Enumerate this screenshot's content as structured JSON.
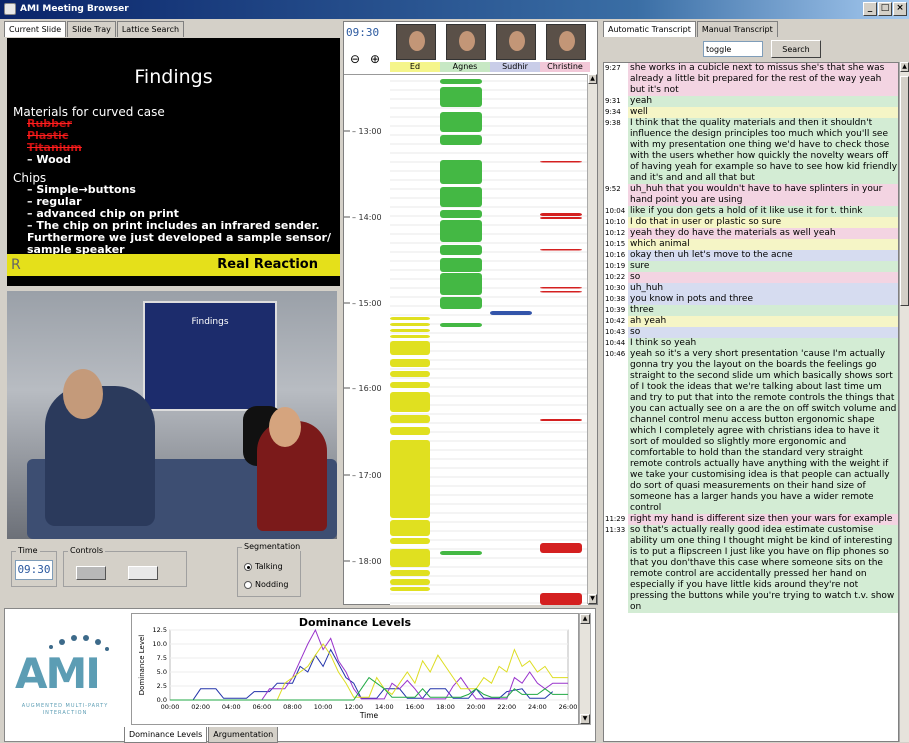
{
  "window": {
    "title": "AMI Meeting Browser",
    "buttons": [
      "_",
      "□",
      "×"
    ]
  },
  "left_tabs": [
    "Current Slide",
    "Slide Tray",
    "Lattice Search"
  ],
  "slide": {
    "title": "Findings",
    "items": [
      {
        "level": 1,
        "text": "Materials for curved case",
        "strike": false
      },
      {
        "level": 2,
        "text": "Rubber",
        "strike": true
      },
      {
        "level": 2,
        "text": "Plastic",
        "strike": true
      },
      {
        "level": 2,
        "text": "Titanium",
        "strike": true
      },
      {
        "level": 2,
        "text": "– Wood",
        "strike": false
      },
      {
        "level": 1,
        "text": "Chips",
        "strike": false
      },
      {
        "level": 2,
        "text": "– Simple→buttons",
        "strike": false
      },
      {
        "level": 2,
        "text": "– regular",
        "strike": false
      },
      {
        "level": 2,
        "text": "– advanced chip on print",
        "strike": false
      },
      {
        "level": 2,
        "text": "– The chip on print includes an infrared sender. Furthermore we just developed a sample sensor/ sample speaker",
        "strike": false
      }
    ],
    "footer": "Real Reaction",
    "footer_logo": "R"
  },
  "video": {
    "screen_title": "Findings"
  },
  "controls": {
    "time_label": "Time",
    "time_value": "09:30",
    "controls_label": "Controls",
    "segmentation_label": "Segmentation",
    "seg_options": [
      {
        "label": "Talking",
        "selected": true
      },
      {
        "label": "Nodding",
        "selected": false
      }
    ]
  },
  "timeline": {
    "clock": "09:30",
    "zoom_out": "🔍−",
    "zoom_in": "🔍+",
    "participants": [
      {
        "name": "Ed",
        "color": "#f5f58a"
      },
      {
        "name": "Agnes",
        "color": "#c7e8c4"
      },
      {
        "name": "Sudhir",
        "color": "#c9cde8"
      },
      {
        "name": "Christine",
        "color": "#f2c8d8"
      }
    ],
    "time_labels": [
      "13:00",
      "14:00",
      "15:00",
      "16:00",
      "17:00",
      "18:00"
    ],
    "colors": {
      "ed": "#e0e020",
      "agnes": "#44b844",
      "sudhir": "#3355aa",
      "christine": "#d42020"
    }
  },
  "dominance": {
    "logo_text": "AMI",
    "logo_sub": "AUGMENTED MULTI-PARTY INTERACTION",
    "tabs": [
      "Dominance Levels",
      "Argumentation"
    ]
  },
  "chart_data": {
    "type": "line",
    "title": "Dominance Levels",
    "xlabel": "Time",
    "ylabel": "Dominance Level",
    "x_ticks": [
      "00:00",
      "02:00",
      "04:00",
      "06:00",
      "08:00",
      "10:00",
      "12:00",
      "14:00",
      "16:00",
      "18:00",
      "20:00",
      "22:00",
      "24:00",
      "26:00"
    ],
    "y_ticks": [
      "0.0",
      "2.5",
      "5.0",
      "7.5",
      "10.0",
      "12.5"
    ],
    "xlim": [
      0,
      26
    ],
    "ylim": [
      0,
      12.5
    ],
    "series": [
      {
        "color": "#2233aa",
        "values": [
          [
            0,
            0
          ],
          [
            1.5,
            0
          ],
          [
            2,
            2
          ],
          [
            3,
            2
          ],
          [
            3.5,
            0.3
          ],
          [
            5,
            0.3
          ],
          [
            5.5,
            1.5
          ],
          [
            6.5,
            1.5
          ],
          [
            7,
            3
          ],
          [
            8,
            3
          ],
          [
            8.5,
            6
          ],
          [
            9,
            5
          ],
          [
            9.5,
            8
          ],
          [
            10,
            6
          ],
          [
            10.5,
            9
          ],
          [
            11,
            6.5
          ],
          [
            11.5,
            4
          ],
          [
            12,
            3
          ],
          [
            12.5,
            0.3
          ],
          [
            13.5,
            0.3
          ],
          [
            14,
            2
          ],
          [
            15,
            2
          ],
          [
            15.5,
            0.3
          ],
          [
            16.5,
            0.3
          ],
          [
            17,
            2
          ],
          [
            18,
            2
          ],
          [
            18.5,
            0.3
          ],
          [
            19.5,
            0.3
          ],
          [
            20,
            2
          ],
          [
            20.5,
            0.3
          ],
          [
            21.5,
            0.3
          ],
          [
            22,
            1.5
          ],
          [
            23,
            2
          ],
          [
            23.5,
            0.3
          ],
          [
            24.5,
            0.3
          ],
          [
            25,
            1.5
          ]
        ]
      },
      {
        "color": "#9933cc",
        "values": [
          [
            0,
            0
          ],
          [
            6,
            0
          ],
          [
            6.5,
            2
          ],
          [
            7.5,
            2
          ],
          [
            8,
            4
          ],
          [
            8.5,
            7
          ],
          [
            9,
            10
          ],
          [
            9.5,
            12.5
          ],
          [
            10,
            9
          ],
          [
            10.5,
            11
          ],
          [
            11,
            7
          ],
          [
            11.5,
            5
          ],
          [
            12,
            2
          ],
          [
            12.5,
            0.2
          ],
          [
            14,
            0.2
          ],
          [
            14.5,
            3
          ],
          [
            15,
            2
          ],
          [
            15.5,
            3.5
          ],
          [
            16,
            2
          ],
          [
            16.5,
            0.2
          ],
          [
            18,
            0.2
          ],
          [
            18.5,
            2.5
          ],
          [
            19,
            4
          ],
          [
            19.5,
            2
          ],
          [
            20,
            0.2
          ],
          [
            22,
            0.2
          ],
          [
            22.5,
            4
          ],
          [
            23,
            3
          ],
          [
            23.5,
            5
          ],
          [
            24,
            3
          ],
          [
            24.5,
            2
          ],
          [
            25,
            3
          ],
          [
            26,
            3
          ]
        ]
      },
      {
        "color": "#dddd22",
        "values": [
          [
            0,
            0
          ],
          [
            7,
            0
          ],
          [
            7.5,
            3
          ],
          [
            8.5,
            5
          ],
          [
            9,
            6
          ],
          [
            9.5,
            8
          ],
          [
            10,
            10
          ],
          [
            10.5,
            8
          ],
          [
            11,
            5
          ],
          [
            11.5,
            3
          ],
          [
            12,
            0.5
          ],
          [
            13,
            0.5
          ],
          [
            13.5,
            4
          ],
          [
            14,
            2
          ],
          [
            14.5,
            1
          ],
          [
            15,
            3
          ],
          [
            15.5,
            5
          ],
          [
            16,
            3
          ],
          [
            16.5,
            7
          ],
          [
            17,
            5
          ],
          [
            17.5,
            8
          ],
          [
            18,
            6
          ],
          [
            18.5,
            4
          ],
          [
            19,
            2
          ],
          [
            20,
            2
          ],
          [
            20.5,
            4
          ],
          [
            21,
            3
          ],
          [
            21.5,
            6
          ],
          [
            22,
            5
          ],
          [
            22.5,
            9
          ],
          [
            23,
            6
          ],
          [
            23.5,
            7
          ],
          [
            24,
            5
          ],
          [
            24.5,
            6
          ],
          [
            25,
            4
          ],
          [
            26,
            4
          ]
        ]
      },
      {
        "color": "#22aa44",
        "values": [
          [
            0,
            0
          ],
          [
            12,
            0
          ],
          [
            12.5,
            2
          ],
          [
            13,
            4
          ],
          [
            13.5,
            3
          ],
          [
            14,
            2
          ],
          [
            14.5,
            0.5
          ],
          [
            16,
            0.5
          ],
          [
            16.5,
            2
          ],
          [
            17,
            0.5
          ],
          [
            19,
            0.5
          ],
          [
            19.5,
            1
          ],
          [
            20,
            2
          ],
          [
            20.5,
            1
          ],
          [
            21,
            0.5
          ],
          [
            22,
            0.5
          ],
          [
            22.5,
            2
          ],
          [
            23,
            1
          ],
          [
            24,
            1
          ],
          [
            24.5,
            2
          ],
          [
            25,
            1
          ],
          [
            26,
            1
          ]
        ]
      }
    ]
  },
  "transcript_tabs": [
    "Automatic Transcript",
    "Manual Transcript"
  ],
  "search": {
    "value": "toggle",
    "button": "Search"
  },
  "transcript": [
    {
      "time": "9:27",
      "color": "pink",
      "text": "she works in a cubicle next to missus she's that she was already a little bit prepared for the rest of the way yeah but it's not"
    },
    {
      "time": "9:31",
      "color": "green",
      "text": "yeah"
    },
    {
      "time": "9:34",
      "color": "yellow",
      "text": "well"
    },
    {
      "time": "9:38",
      "color": "green",
      "text": "I think that the quality materials and then it shouldn't influence the design principles too much which you'll see with my presentation one thing we'd have to check those with the users whether how quickly the novelty wears off of having yeah for example so have to see how kid friendly and it's and and all that but"
    },
    {
      "time": "9:52",
      "color": "pink",
      "text": "uh_huh that you wouldn't have to have splinters in your hand point you are using"
    },
    {
      "time": "10:04",
      "color": "green",
      "text": "like if you don gets a hold of it like use it for t. think"
    },
    {
      "time": "10:10",
      "color": "yellow",
      "text": "I do that in user or plastic so sure"
    },
    {
      "time": "10:12",
      "color": "pink",
      "text": "yeah they do have the materials as well yeah"
    },
    {
      "time": "10:15",
      "color": "yellow",
      "text": "which animal"
    },
    {
      "time": "10:16",
      "color": "blue",
      "text": "okay then uh let's move to the acne"
    },
    {
      "time": "10:19",
      "color": "green",
      "text": "sure"
    },
    {
      "time": "10:22",
      "color": "pink",
      "text": "so"
    },
    {
      "time": "10:30",
      "color": "blue",
      "text": "uh_huh"
    },
    {
      "time": "10:38",
      "color": "blue",
      "text": "you know in pots and three"
    },
    {
      "time": "10:39",
      "color": "green",
      "text": "three"
    },
    {
      "time": "10:42",
      "color": "yellow",
      "text": "ah yeah"
    },
    {
      "time": "10:43",
      "color": "blue",
      "text": "so"
    },
    {
      "time": "10:44",
      "color": "green",
      "text": "I think so yeah"
    },
    {
      "time": "10:46",
      "color": "green",
      "text": "yeah so it's a very short presentation 'cause I'm actually gonna try you the layout on the boards the feelings go straight to the second slide um which basically shows sort of I took the ideas that we're talking about last time um and try to put that into the remote controls the things that you can actually see on a are the on off switch volume and channel control menu access button ergonomic shape which I completely agree with christians idea to have it sort of moulded so slightly more ergonomic and comfortable to hold than the standard very straight remote controls actually have anything with the weight if we take your customising idea is that people can actually do sort of quasi measurements on their hand size of someone has a larger hands you have a wider remote control"
    },
    {
      "time": "11:29",
      "color": "pink",
      "text": "right my hand is different size then your wars for example"
    },
    {
      "time": "11:33",
      "color": "green",
      "text": "so that's actually really good idea estimate customise ability um one thing I thought might be kind of interesting is to put a flipscreen I just like you have on flip phones so that you don'thave this case where someone sits on the remote control are accidentally pressed her hand on especially if you have little kids around they're not pressing the buttons while you're trying to watch t.v. show on"
    }
  ]
}
